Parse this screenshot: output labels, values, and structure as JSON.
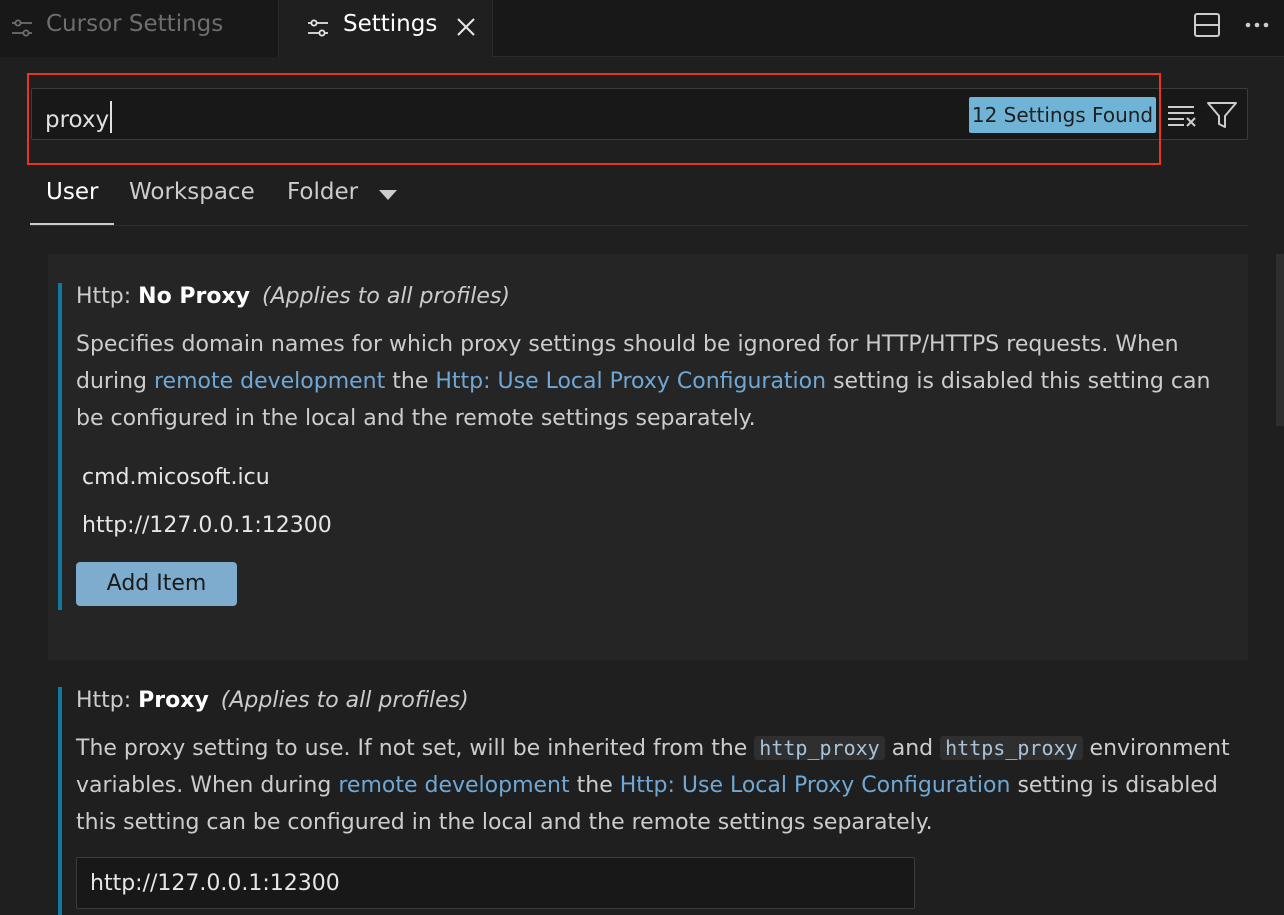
{
  "tabs": [
    {
      "label": "Cursor Settings",
      "active": false,
      "icon": "settings-sliders-icon"
    },
    {
      "label": "Settings",
      "active": true,
      "icon": "settings-sliders-icon",
      "close_icon": "close-icon"
    }
  ],
  "top_actions": [
    {
      "icon": "split-editor-icon"
    },
    {
      "icon": "more-actions-icon",
      "glyph": "···"
    }
  ],
  "search": {
    "value": "proxy",
    "results_badge": "12 Settings Found",
    "clear_icon": "clear-filter-icon",
    "filter_icon": "filter-icon"
  },
  "scopes": {
    "user": "User",
    "workspace": "Workspace",
    "folder": "Folder"
  },
  "settings": [
    {
      "category": "Http: ",
      "name": "No Proxy",
      "applies": "(Applies to all profiles)",
      "desc_part1": "Specifies domain names for which proxy settings should be ignored for HTTP/HTTPS requests. When during ",
      "desc_link1": "remote development",
      "desc_part2": " the ",
      "desc_link2": "Http: Use Local Proxy Configuration",
      "desc_part3": " setting is disabled this setting can be configured in the local and the remote settings separately.",
      "items": [
        "cmd.micosoft.icu",
        "http://127.0.0.1:12300"
      ],
      "add_item_label": "Add Item"
    },
    {
      "category": "Http: ",
      "name": "Proxy",
      "applies": "(Applies to all profiles)",
      "desc_part1": "The proxy setting to use. If not set, will be inherited from the ",
      "desc_code1": "http_proxy",
      "desc_part2": " and ",
      "desc_code2": "https_proxy",
      "desc_part3": " environment variables. When during ",
      "desc_link1": "remote development",
      "desc_part4": " the ",
      "desc_link2": "Http: Use Local Proxy Configuration",
      "desc_part5": " setting is disabled this setting can be configured in the local and the remote settings separately.",
      "value": "http://127.0.0.1:12300"
    }
  ],
  "colors": {
    "accent": "#0e7aa0",
    "badge": "#6fb4d6",
    "link": "#6fa8d6",
    "highlight_border": "#e8351f",
    "button": "#7eaccf"
  }
}
